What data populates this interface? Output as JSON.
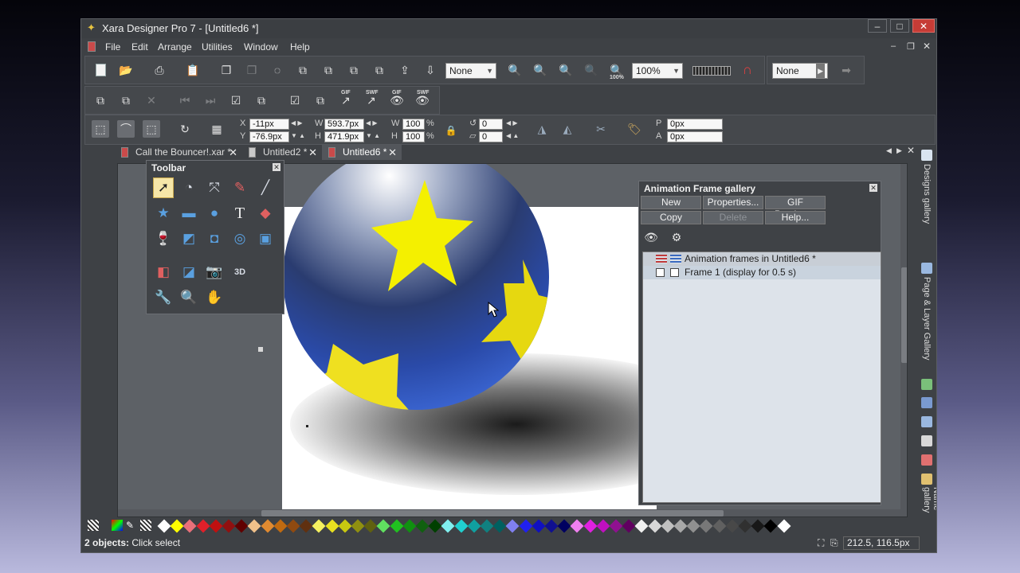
{
  "window": {
    "title": "Xara Designer Pro 7 - [Untitled6 *]"
  },
  "menu": [
    {
      "label": "File"
    },
    {
      "label": "Edit"
    },
    {
      "label": "Arrange"
    },
    {
      "label": "Utilities"
    },
    {
      "label": "Window"
    },
    {
      "label": "Help"
    }
  ],
  "toolbar1": {
    "quality_select": "None",
    "zoom_select": "100%",
    "feather_select": "None",
    "zoom100_label": "100%"
  },
  "toolbar2": {
    "gif1": "GIF",
    "swf1": "SWF",
    "gif2": "GIF",
    "swf2": "SWF"
  },
  "infobar": {
    "x_label": "X",
    "x_value": "-11px",
    "y_label": "Y",
    "y_value": "-76.9px",
    "w_label": "W",
    "w_value": "593.7px",
    "h_label": "H",
    "h_value": "471.9px",
    "sw_label": "W",
    "sw_value": "100",
    "sh_label": "H",
    "sh_value": "100",
    "pct": "%",
    "rot_value": "0",
    "skew_value": "0",
    "p_label": "P",
    "p_value": "0px",
    "a_label": "A",
    "a_value": "0px"
  },
  "doc_tabs": [
    {
      "label": "Call the Bouncer!.xar *"
    },
    {
      "label": "Untitled2 *"
    },
    {
      "label": "Untitled6 *"
    }
  ],
  "toolbar_panel": {
    "title": "Toolbar",
    "text_tool": "T",
    "tool_3d": "3D"
  },
  "animation_gallery": {
    "title": "Animation Frame gallery",
    "buttons": {
      "new": "New",
      "properties": "Properties...",
      "gif_preview": "GIF Preview...",
      "copy": "Copy",
      "delete": "Delete",
      "help": "Help..."
    },
    "rows": [
      {
        "label": "Animation frames in Untitled6 *"
      },
      {
        "label": "Frame 1 (display for 0.5 s)"
      }
    ]
  },
  "right_rail": {
    "designs": "Designs gallery",
    "page_layer": "Page & Layer Gallery",
    "name_gallery": "Name gallery"
  },
  "palette": {
    "colors": [
      "#ffffff",
      "#ffff00",
      "#e8707a",
      "#e0202a",
      "#c01010",
      "#901010",
      "#600000",
      "#f0c08a",
      "#e08a30",
      "#c06a10",
      "#904a10",
      "#603010",
      "#f4f060",
      "#e8e020",
      "#c8c810",
      "#909010",
      "#606010",
      "#60e060",
      "#20c020",
      "#109010",
      "#106010",
      "#004000",
      "#80f0f0",
      "#20d0d0",
      "#10a0a0",
      "#108080",
      "#006060",
      "#8080f0",
      "#2020f0",
      "#1010c0",
      "#101090",
      "#000060",
      "#f080f0",
      "#e020e0",
      "#c010c0",
      "#901090",
      "#600060",
      "#f0f0f0",
      "#d8d8d8",
      "#c0c0c0",
      "#a8a8a8",
      "#909090",
      "#787878",
      "#606060",
      "#484848",
      "#303030",
      "#181818",
      "#000000",
      "#ffffff"
    ]
  },
  "status": {
    "text_bold": "2 objects:",
    "text": " Click select",
    "coords": "212.5, 116.5px"
  }
}
